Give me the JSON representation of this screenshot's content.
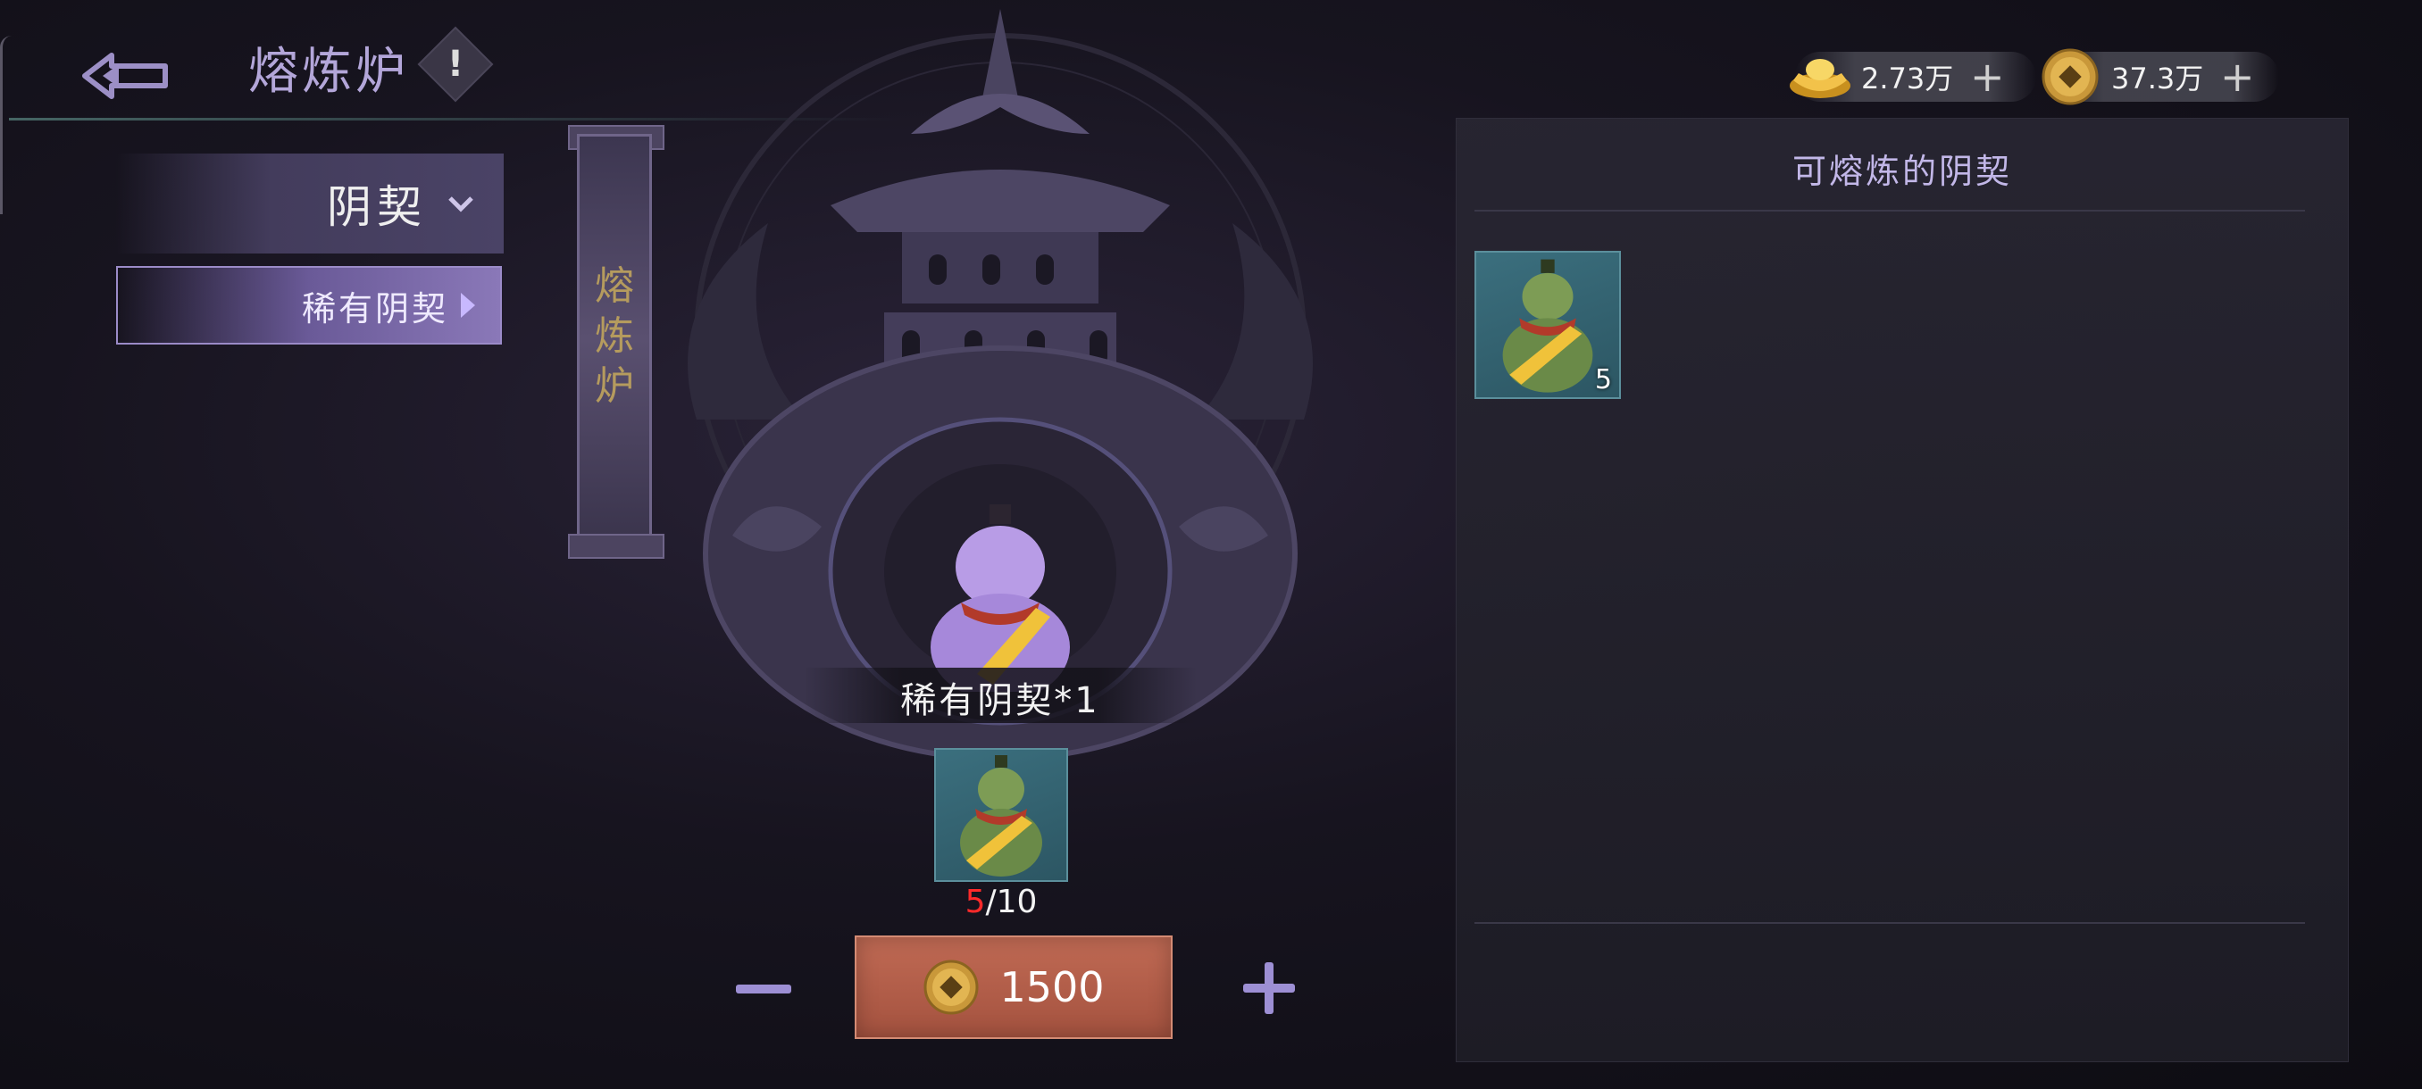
{
  "header": {
    "title": "熔炼炉",
    "info_symbol": "!"
  },
  "currencies": [
    {
      "icon": "gold-ingot-icon",
      "value": "2.73万"
    },
    {
      "icon": "copper-coin-icon",
      "value": "37.3万"
    }
  ],
  "sidebar": {
    "category": "阴契",
    "subcategory": "稀有阴契"
  },
  "banner": {
    "chars": [
      "熔",
      "炼",
      "炉"
    ]
  },
  "furnace": {
    "product_label": "稀有阴契*1",
    "material": {
      "icon": "green-gourd-icon",
      "have": "5",
      "need": "/10"
    },
    "smelt_cost": "1500",
    "minus_symbol": "−",
    "plus_symbol": "+"
  },
  "inventory": {
    "title": "可熔炼的阴契",
    "items": [
      {
        "icon": "green-gourd-icon",
        "qty": "5"
      }
    ]
  },
  "colors": {
    "accent_purple": "#b3a6d9",
    "smelt_button": "#b85f49",
    "material_shortage": "#ff2a2a"
  }
}
